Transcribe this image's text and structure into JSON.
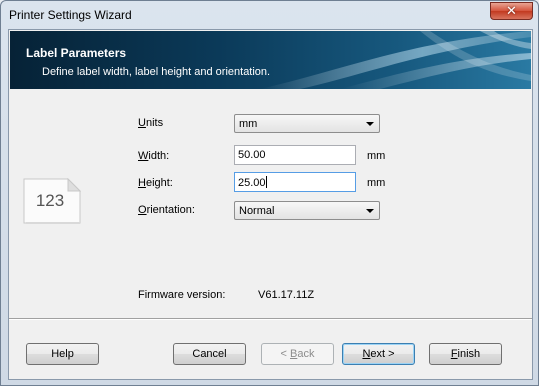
{
  "window": {
    "title": "Printer Settings Wizard",
    "close_glyph": "✕"
  },
  "banner": {
    "title": "Label Parameters",
    "subtitle": "Define label width, label height and orientation."
  },
  "icon": {
    "name": "label-file-icon",
    "text": "123"
  },
  "form": {
    "units": {
      "label_accesskey": "U",
      "label_rest": "nits",
      "value": "mm"
    },
    "width": {
      "label_accesskey": "W",
      "label_rest": "idth:",
      "value": "50.00",
      "unit": "mm"
    },
    "height": {
      "label_accesskey": "H",
      "label_rest": "eight:",
      "value": "25.00",
      "unit": "mm"
    },
    "orientation": {
      "label_accesskey": "O",
      "label_rest": "rientation:",
      "value": "Normal"
    },
    "firmware": {
      "label": "Firmware version:",
      "value": "V61.17.11Z"
    }
  },
  "buttons": {
    "help": "Help",
    "cancel": "Cancel",
    "back_prefix": "< ",
    "back_accesskey": "B",
    "back_rest": "ack",
    "next_accesskey": "N",
    "next_rest": "ext >",
    "finish_accesskey": "F",
    "finish_rest": "inish"
  }
}
